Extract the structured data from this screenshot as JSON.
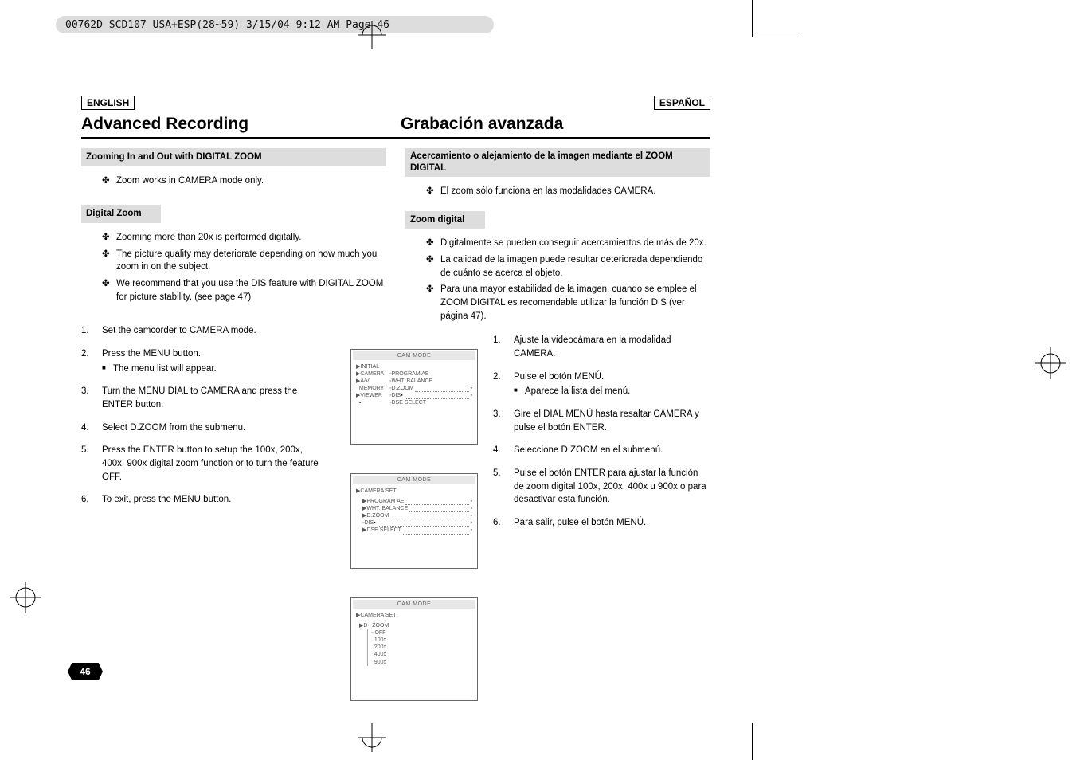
{
  "header_band": "00762D SCD107 USA+ESP(28~59)  3/15/04 9:12 AM  Page 46",
  "lang_left": "ENGLISH",
  "lang_right": "ESPAÑOL",
  "title_left": "Advanced Recording",
  "title_right": "Grabación avanzada",
  "left": {
    "sec1_head": "Zooming In and Out with DIGITAL ZOOM",
    "sec1_b1": "Zoom works in CAMERA mode only.",
    "sec2_head": "Digital Zoom",
    "sec2_b1": "Zooming more than 20x is performed digitally.",
    "sec2_b2": "The picture quality may deteriorate depending on how much you zoom in on the subject.",
    "sec2_b3": "We recommend that you use the DIS feature with DIGITAL ZOOM for picture stability. (see page 47)",
    "n1": "Set the camcorder to CAMERA mode.",
    "n2": "Press the MENU button.",
    "n2s": "The menu list will appear.",
    "n3": "Turn the MENU DIAL to CAMERA and press the ENTER button.",
    "n4": "Select D.ZOOM from the submenu.",
    "n5": "Press the ENTER button to setup the 100x, 200x, 400x, 900x digital zoom function or to turn the feature OFF.",
    "n6": "To exit, press the MENU button."
  },
  "right": {
    "sec1_head": "Acercamiento o alejamiento de la imagen mediante el ZOOM DIGITAL",
    "sec1_b1": "El zoom sólo funciona en las modalidades CAMERA.",
    "sec2_head": "Zoom digital",
    "sec2_b1": "Digitalmente se pueden conseguir acercamientos de más de 20x.",
    "sec2_b2": "La calidad de la imagen puede resultar deteriorada dependiendo de cuánto se acerca el objeto.",
    "sec2_b3": "Para una mayor estabilidad de la imagen, cuando se emplee el ZOOM DIGITAL es recomendable utilizar la función DIS (ver página 47).",
    "n1": "Ajuste la videocámara en la modalidad CAMERA.",
    "n2": "Pulse el botón MENÚ.",
    "n2s": "Aparece la lista del menú.",
    "n3": "Gire el DIAL MENÚ hasta resaltar CAMERA y pulse el botón ENTER.",
    "n4": "Seleccione D.ZOOM en el submenú.",
    "n5": "Pulse el botón ENTER para ajustar la función de zoom digital 100x, 200x, 400x u 900x o para desactivar esta función.",
    "n6": "Para salir, pulse el botón MENÚ."
  },
  "figs": {
    "cap": "CAM  MODE",
    "p1l1": "INITIAL",
    "p1l2": "CAMERA",
    "p1l2b": "PROGRAM AE",
    "p1l3": "A/V",
    "p1l3b": "WHT. BALANCE",
    "p1l4": "MEMORY",
    "p1l4b": "D.ZOOM",
    "p1l5": "VIEWER",
    "p1l5b": "DIS",
    "p1l6b": "DSE SELECT",
    "p2l1": "CAMERA SET",
    "p2l2": "PROGRAM AE",
    "p2l3": "WHT. BALANCE",
    "p2l4": "D.ZOOM",
    "p2l5": "DIS",
    "p2l6": "DSE SELECT",
    "p3l1": "CAMERA SET",
    "p3l2": "D . ZOOM",
    "p3l3": "OFF",
    "p3l4": "100x",
    "p3l5": "200x",
    "p3l6": "400x",
    "p3l7": "900x"
  },
  "page_num": "46",
  "nums": {
    "n1": "1.",
    "n2": "2.",
    "n3": "3.",
    "n4": "4.",
    "n5": "5.",
    "n6": "6."
  },
  "marks": {
    "plus": "✤",
    "square": "■"
  }
}
